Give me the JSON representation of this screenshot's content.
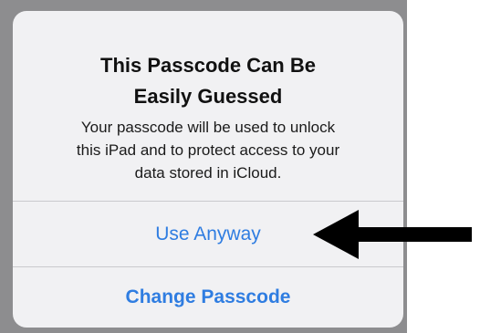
{
  "alert": {
    "title_line1": "This Passcode Can Be",
    "title_line2": "Easily Guessed",
    "message_line1": "Your passcode will be used to unlock",
    "message_line2": "this iPad and to protect access to your",
    "message_line3": "data stored in iCloud.",
    "use_anyway_label": "Use Anyway",
    "change_passcode_label": "Change Passcode"
  },
  "colors": {
    "backdrop": "#8d8d8f",
    "alert_background": "#f1f1f3",
    "button_text": "#2f7de1",
    "arrow": "#000000"
  },
  "icons": {
    "annotation_arrow": "arrow-left-icon"
  }
}
